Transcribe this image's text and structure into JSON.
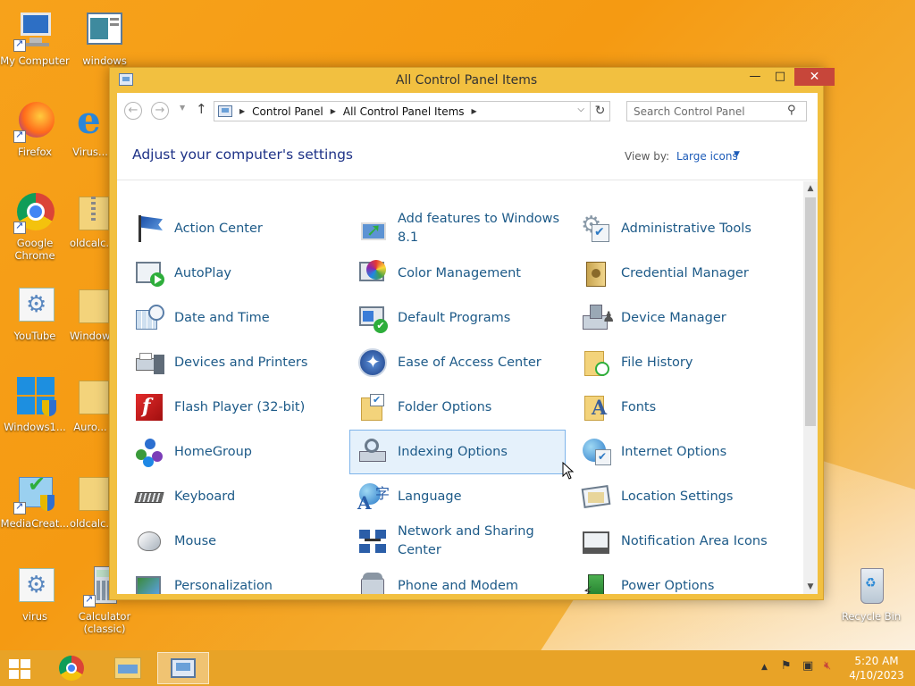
{
  "desktop": {
    "icons": [
      {
        "label": "My Computer"
      },
      {
        "label": "windows"
      },
      {
        "label": "Firefox"
      },
      {
        "label": "Virus..."
      },
      {
        "label": "Google Chrome"
      },
      {
        "label": "oldcalc..."
      },
      {
        "label": "YouTube"
      },
      {
        "label": "Window..."
      },
      {
        "label": "Windows1..."
      },
      {
        "label": "Auro..."
      },
      {
        "label": "MediaCreat..."
      },
      {
        "label": "oldcalc..."
      },
      {
        "label": "virus"
      },
      {
        "label": "Calculator (classic)"
      },
      {
        "label": "Recycle Bin"
      }
    ]
  },
  "window": {
    "title": "All Control Panel Items",
    "minimize": "—",
    "maximize": "□",
    "close": "✕"
  },
  "address": {
    "crumbs": [
      "Control Panel",
      "All Control Panel Items"
    ],
    "search_placeholder": "Search Control Panel"
  },
  "header": {
    "title": "Adjust your computer's settings",
    "view_by_label": "View by:",
    "view_by_value": "Large icons"
  },
  "items": [
    {
      "label": "Action Center",
      "icon": "flag-icon"
    },
    {
      "label": "Add features to Windows 8.1",
      "icon": "add-features-icon"
    },
    {
      "label": "Administrative Tools",
      "icon": "admin-tools-icon"
    },
    {
      "label": "AutoPlay",
      "icon": "autoplay-icon"
    },
    {
      "label": "Color Management",
      "icon": "color-management-icon"
    },
    {
      "label": "Credential Manager",
      "icon": "credential-safe-icon"
    },
    {
      "label": "Date and Time",
      "icon": "calendar-clock-icon"
    },
    {
      "label": "Default Programs",
      "icon": "default-programs-icon"
    },
    {
      "label": "Device Manager",
      "icon": "device-manager-icon"
    },
    {
      "label": "Devices and Printers",
      "icon": "printer-icon"
    },
    {
      "label": "Ease of Access Center",
      "icon": "ease-of-access-icon"
    },
    {
      "label": "File History",
      "icon": "file-history-icon"
    },
    {
      "label": "Flash Player (32-bit)",
      "icon": "flash-icon"
    },
    {
      "label": "Folder Options",
      "icon": "folder-options-icon"
    },
    {
      "label": "Fonts",
      "icon": "fonts-folder-icon"
    },
    {
      "label": "HomeGroup",
      "icon": "homegroup-icon"
    },
    {
      "label": "Indexing Options",
      "icon": "indexing-icon"
    },
    {
      "label": "Internet Options",
      "icon": "globe-icon"
    },
    {
      "label": "Keyboard",
      "icon": "keyboard-icon"
    },
    {
      "label": "Language",
      "icon": "language-icon"
    },
    {
      "label": "Location Settings",
      "icon": "location-icon"
    },
    {
      "label": "Mouse",
      "icon": "mouse-icon"
    },
    {
      "label": "Network and Sharing Center",
      "icon": "network-icon"
    },
    {
      "label": "Notification Area Icons",
      "icon": "notification-icon"
    },
    {
      "label": "Personalization",
      "icon": "personalization-icon"
    },
    {
      "label": "Phone and Modem",
      "icon": "phone-icon"
    },
    {
      "label": "Power Options",
      "icon": "power-icon"
    }
  ],
  "selected_item": "Indexing Options",
  "taskbar": {
    "time": "5:20 AM",
    "date": "4/10/2023"
  },
  "colors": {
    "accent": "#f2c040",
    "link": "#1d5a88",
    "title_blue": "#1e3287",
    "close_red": "#c7463a"
  }
}
